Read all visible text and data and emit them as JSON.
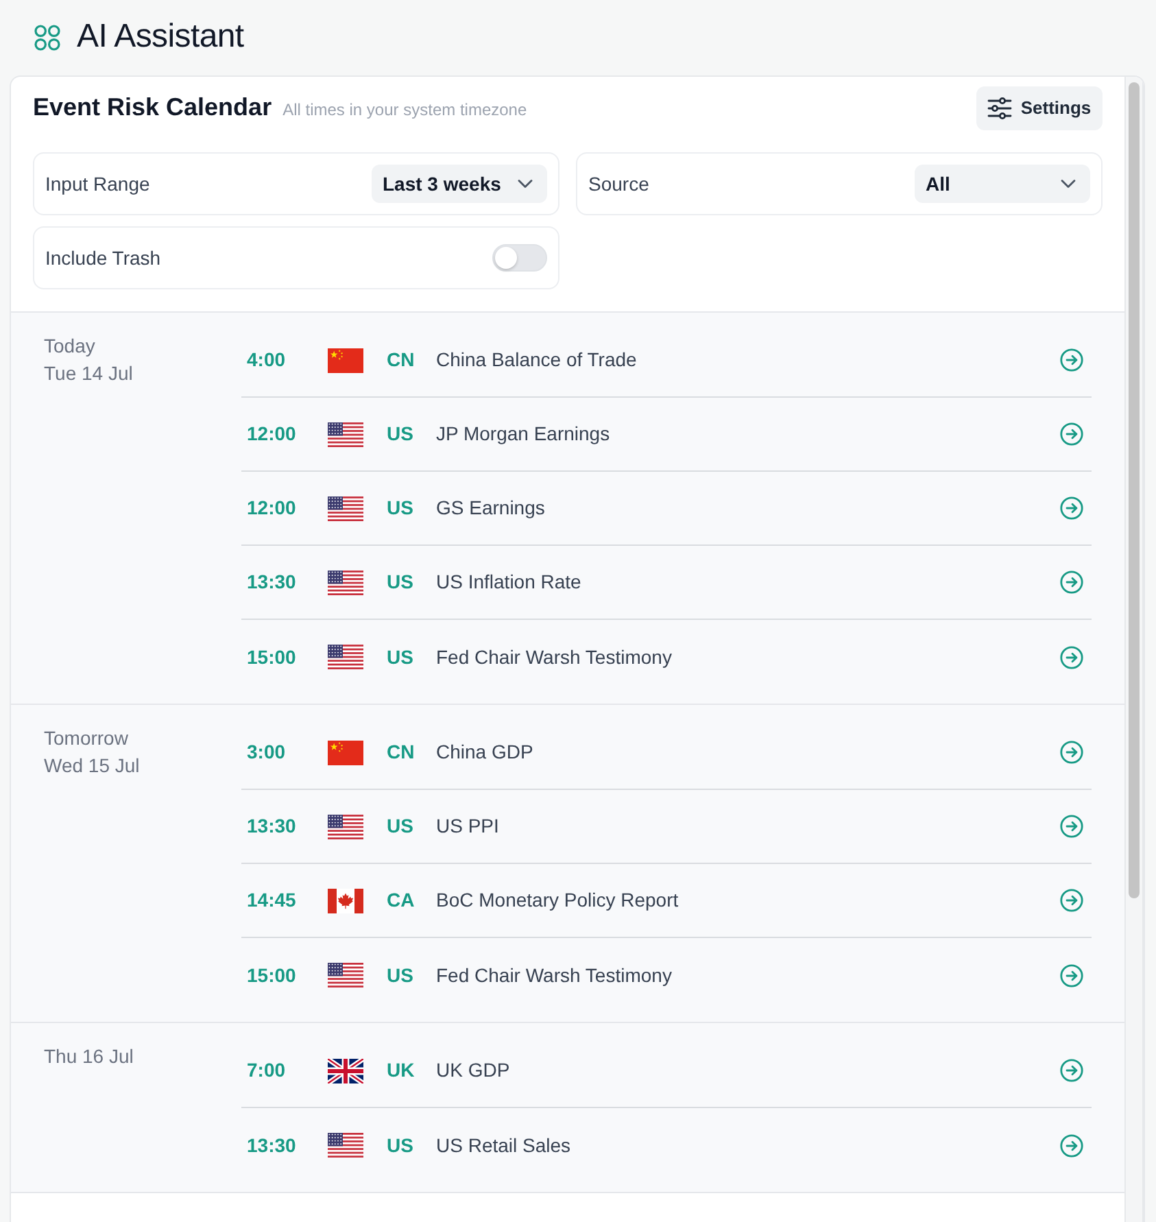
{
  "header": {
    "title": "AI Assistant"
  },
  "calendar": {
    "title": "Event Risk Calendar",
    "subtitle": "All times in your system timezone",
    "settings_button": "Settings",
    "filters": {
      "input_range": {
        "label": "Input Range",
        "value": "Last 3 weeks"
      },
      "source": {
        "label": "Source",
        "value": "All"
      },
      "include_trash": {
        "label": "Include Trash",
        "on": false
      }
    },
    "days": [
      {
        "relative": "Today",
        "date": "Tue 14 Jul",
        "events": [
          {
            "time": "4:00",
            "kind": "china",
            "country": "CN",
            "name": "China Balance of Trade"
          },
          {
            "time": "12:00",
            "kind": "usa",
            "country": "US",
            "name": "JP Morgan Earnings"
          },
          {
            "time": "12:00",
            "kind": "usa",
            "country": "US",
            "name": "GS Earnings"
          },
          {
            "time": "13:30",
            "kind": "usa",
            "country": "US",
            "name": "US Inflation Rate"
          },
          {
            "time": "15:00",
            "kind": "usa",
            "country": "US",
            "name": "Fed Chair Warsh Testimony"
          }
        ]
      },
      {
        "relative": "Tomorrow",
        "date": "Wed 15 Jul",
        "events": [
          {
            "time": "3:00",
            "kind": "china",
            "country": "CN",
            "name": "China GDP"
          },
          {
            "time": "13:30",
            "kind": "usa",
            "country": "US",
            "name": "US PPI"
          },
          {
            "time": "14:45",
            "kind": "canada",
            "country": "CA",
            "name": "BoC Monetary Policy Report"
          },
          {
            "time": "15:00",
            "kind": "usa",
            "country": "US",
            "name": "Fed Chair Warsh Testimony"
          }
        ]
      },
      {
        "date": "Thu 16 Jul",
        "events": [
          {
            "time": "7:00",
            "kind": "uk",
            "country": "UK",
            "name": "UK GDP"
          },
          {
            "time": "13:30",
            "kind": "usa",
            "country": "US",
            "name": "US Retail Sales"
          }
        ]
      }
    ]
  }
}
